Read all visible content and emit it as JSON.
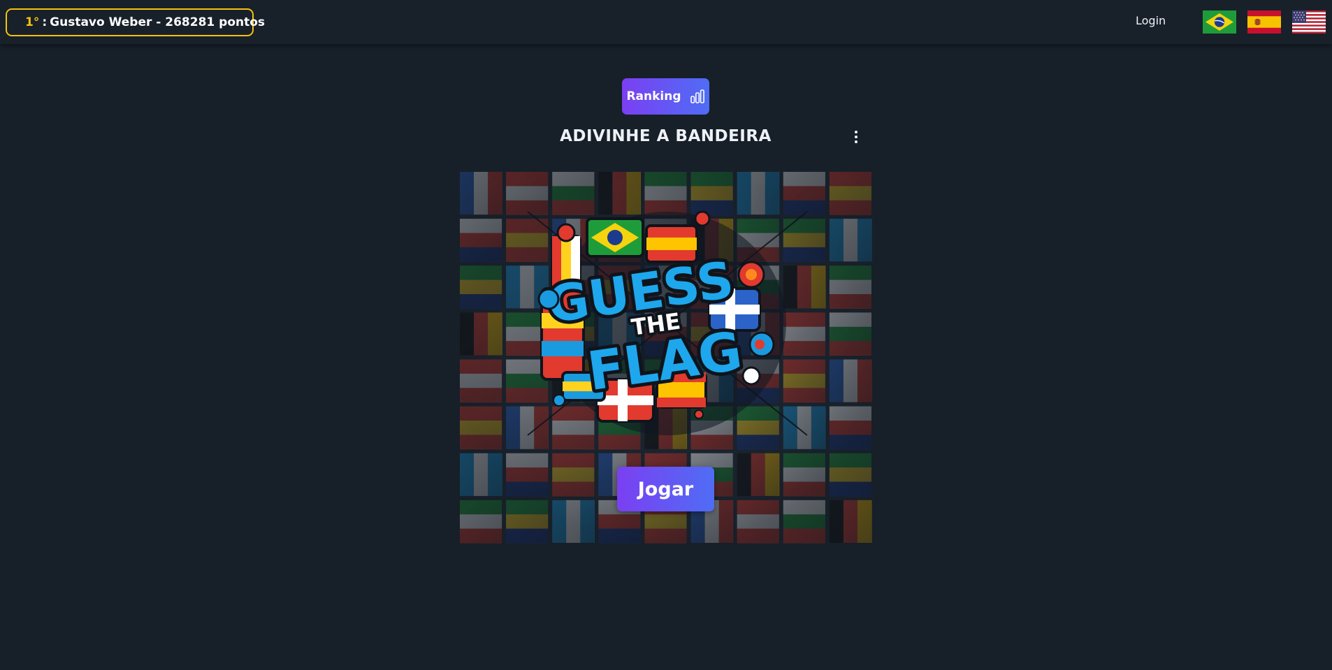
{
  "header": {
    "leader": {
      "rank": "1°",
      "separator": ":",
      "name": "Gustavo Weber - 268281 pontos",
      "icon": "trophy-icon"
    },
    "login_label": "Login",
    "languages": [
      {
        "name": "flag-brazil-icon",
        "lang": "pt"
      },
      {
        "name": "flag-spain-icon",
        "lang": "es"
      },
      {
        "name": "flag-usa-icon",
        "lang": "en"
      }
    ]
  },
  "main": {
    "ranking_label": "Ranking",
    "title": "ADIVINHE A BANDEIRA",
    "logo_text_1": "GUESS",
    "logo_text_2": "THE",
    "logo_text_3": "FLAG",
    "play_label": "Jogar"
  },
  "colors": {
    "background": "#171f29",
    "accent_gold": "#f4c20d",
    "button_gradient_start": "#7b3ff2",
    "button_gradient_end": "#4f6df5"
  }
}
